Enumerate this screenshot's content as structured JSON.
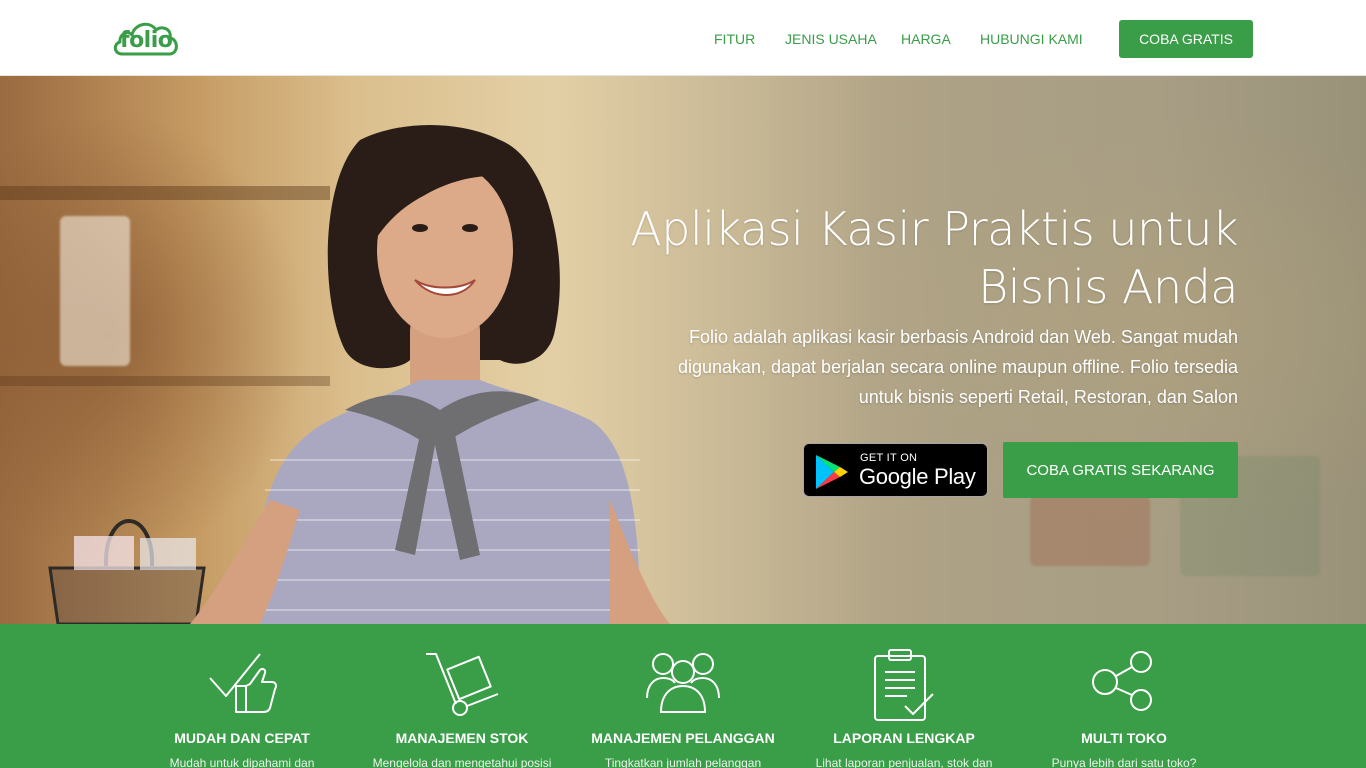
{
  "brand": {
    "logo_text": "folio",
    "color": "#3a9d48"
  },
  "nav": {
    "items": [
      {
        "label": "FITUR"
      },
      {
        "label": "JENIS USAHA"
      },
      {
        "label": "HARGA"
      },
      {
        "label": "HUBUNGI KAMI"
      }
    ],
    "cta_label": "COBA GRATIS"
  },
  "hero": {
    "title_line1": "Aplikasi Kasir Praktis untuk",
    "title_line2": "Bisnis Anda",
    "description_line1": "Folio adalah aplikasi kasir berbasis Android dan Web. Sangat mudah",
    "description_line2": "digunakan, dapat berjalan secara online maupun offline. Folio tersedia",
    "description_line3": "untuk bisnis seperti Retail, Restoran, dan Salon",
    "google_play": {
      "small": "GET IT ON",
      "big": "Google Play"
    },
    "cta_label": "COBA GRATIS SEKARANG"
  },
  "features": [
    {
      "icon": "thumbs-up-check-icon",
      "title": "MUDAH DAN CEPAT",
      "desc": "Mudah untuk dipahami dan"
    },
    {
      "icon": "hand-truck-icon",
      "title": "MANAJEMEN STOK",
      "desc": "Mengelola dan mengetahui posisi"
    },
    {
      "icon": "customers-icon",
      "title": "MANAJEMEN PELANGGAN",
      "desc": "Tingkatkan jumlah pelanggan"
    },
    {
      "icon": "clipboard-report-icon",
      "title": "LAPORAN LENGKAP",
      "desc": "Lihat laporan penjualan, stok dan"
    },
    {
      "icon": "share-network-icon",
      "title": "MULTI TOKO",
      "desc": "Punya lebih dari satu toko?"
    }
  ]
}
